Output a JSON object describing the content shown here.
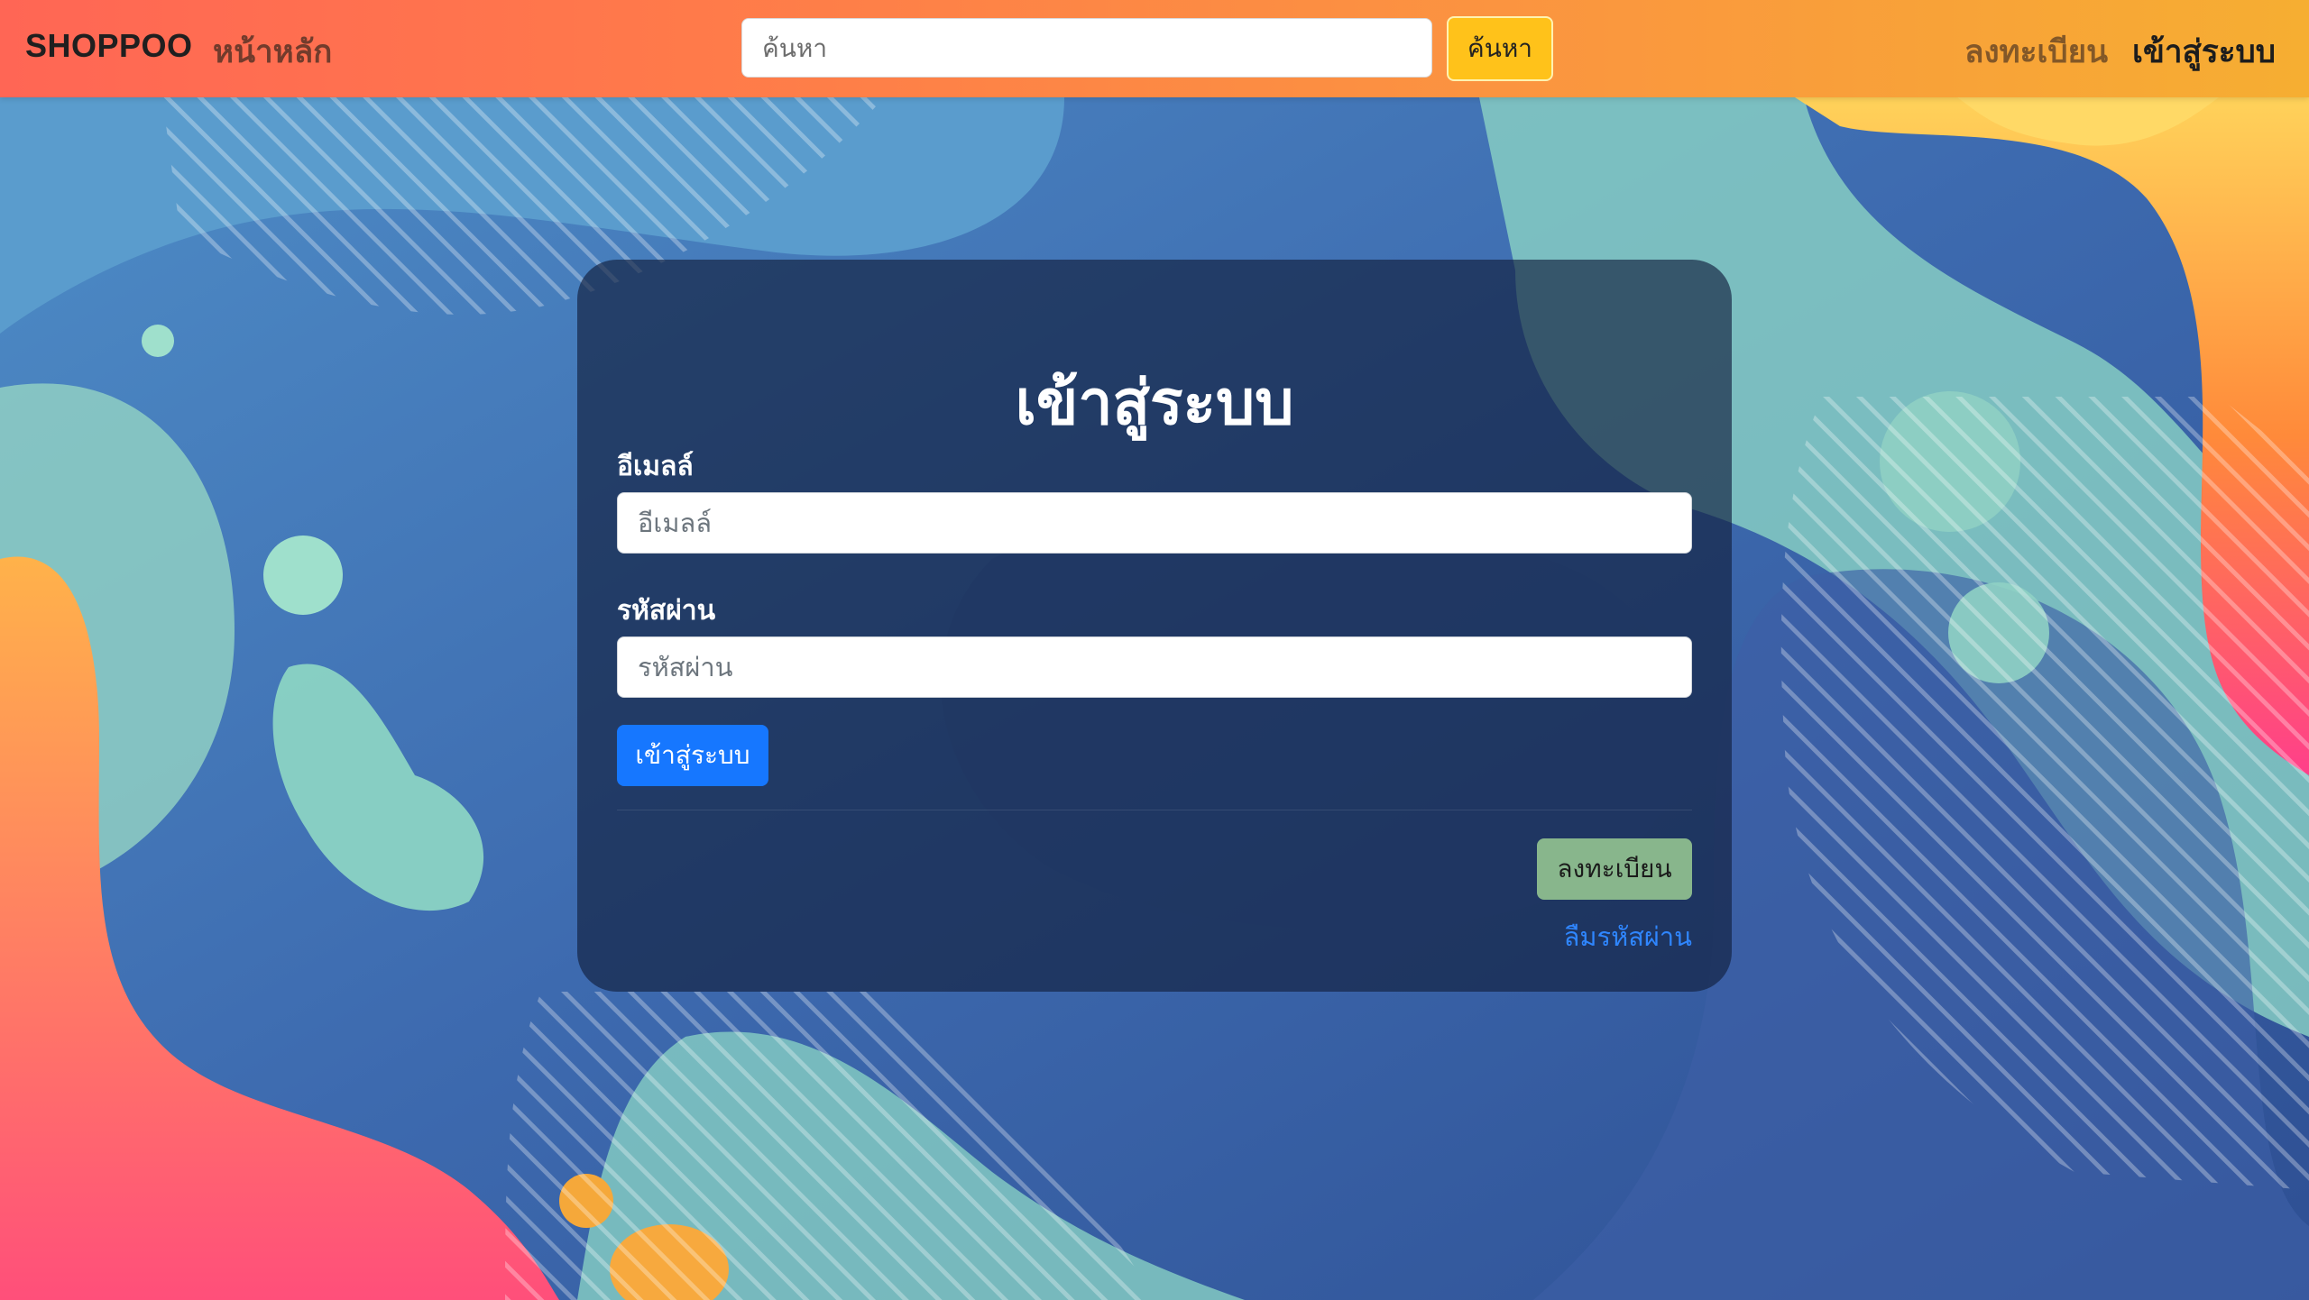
{
  "navbar": {
    "brand": "SHOPPOO",
    "home": "หน้าหลัก",
    "search_placeholder": "ค้นหา",
    "search_button": "ค้นหา",
    "register": "ลงทะเบียน",
    "login": "เข้าสู่ระบบ"
  },
  "login_card": {
    "title": "เข้าสู่ระบบ",
    "email_label": "อีเมลล์",
    "email_placeholder": "อีเมลล์",
    "password_label": "รหัสผ่าน",
    "password_placeholder": "รหัสผ่าน",
    "login_button": "เข้าสู่ระบบ",
    "register_button": "ลงทะเบียน",
    "forgot_password": "ลืมรหัสผ่าน"
  },
  "colors": {
    "navbar_start": "#ff6655",
    "navbar_end": "#f6ae32",
    "search_button": "#ffc21a",
    "primary_button": "#1677ff",
    "register_button": "#88b68c",
    "link": "#2f86ff",
    "card_background": "rgba(18,32,62,0.66)",
    "background_base": "#3f6fb0"
  }
}
